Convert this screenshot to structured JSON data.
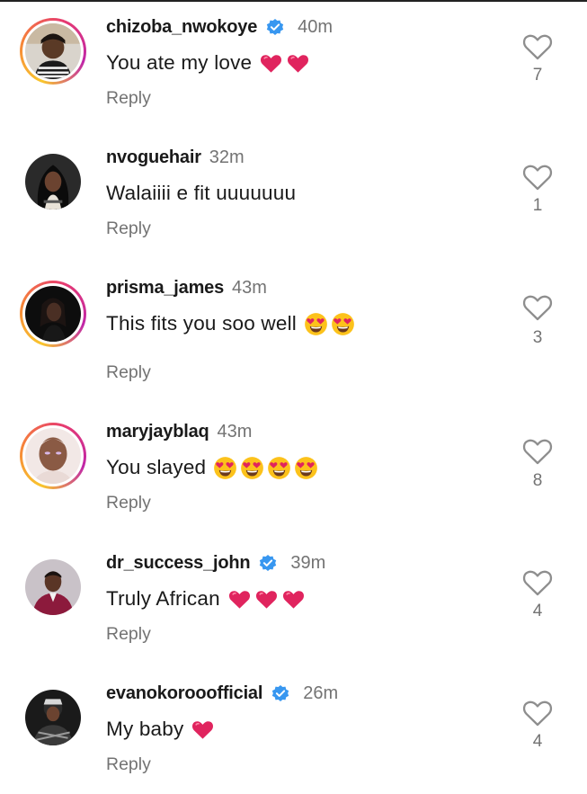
{
  "comments": [
    {
      "username": "chizoba_nwokoye",
      "verified": true,
      "time": "40m",
      "text": "You ate my love",
      "emojis": [
        "red-heart",
        "red-heart"
      ],
      "reply": "Reply",
      "likes": "7",
      "story_ring": true
    },
    {
      "username": "nvoguehair",
      "verified": false,
      "time": "32m",
      "text": "Walaiiii e fit uuuuuuu",
      "emojis": [],
      "reply": "Reply",
      "likes": "1",
      "story_ring": false
    },
    {
      "username": "prisma_james",
      "verified": false,
      "time": "43m",
      "text": "This fits you soo well",
      "emojis": [
        "heart-eyes",
        "heart-eyes"
      ],
      "reply": "Reply",
      "likes": "3",
      "story_ring": true
    },
    {
      "username": "maryjayblaq",
      "verified": false,
      "time": "43m",
      "text": "You slayed",
      "emojis": [
        "heart-eyes",
        "heart-eyes",
        "heart-eyes",
        "heart-eyes"
      ],
      "reply": "Reply",
      "likes": "8",
      "story_ring": true
    },
    {
      "username": "dr_success_john",
      "verified": true,
      "time": "39m",
      "text": "Truly African",
      "emojis": [
        "red-heart",
        "red-heart",
        "red-heart"
      ],
      "reply": "Reply",
      "likes": "4",
      "story_ring": false
    },
    {
      "username": "evanokorooofficial",
      "verified": true,
      "time": "26m",
      "text": "My baby",
      "emojis": [
        "red-heart"
      ],
      "reply": "Reply",
      "likes": "4",
      "story_ring": false
    }
  ],
  "colors": {
    "verified_blue": "#3897f0",
    "heart_red": "#e0245e",
    "muted_text": "#737373"
  }
}
